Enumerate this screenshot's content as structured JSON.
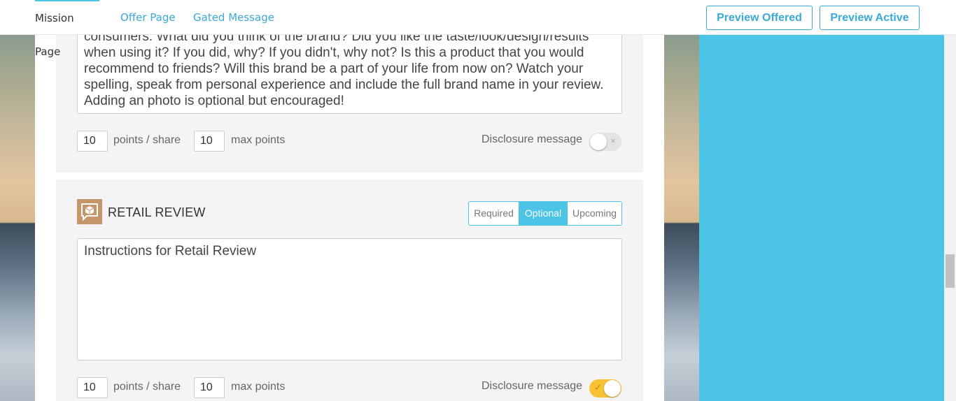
{
  "nav": {
    "tabs": [
      {
        "label": "Mission Page",
        "active": true
      },
      {
        "label": "Offer Page",
        "active": false
      },
      {
        "label": "Gated Message",
        "active": false
      }
    ],
    "preview_offered": "Preview Offered",
    "preview_active": "Preview Active"
  },
  "review_card": {
    "instructions": "consumers. What did you think of the brand? Did you like the taste/look/design/results when using it? If you did, why? If you didn't, why not? Is this a product that you would recommend to friends? Will this brand be a part of your life from now on? Watch your spelling, speak from personal experience and include the full brand name in your review. Adding an photo is optional but encouraged!",
    "points_per_share": "10",
    "points_per_share_label": "points / share",
    "max_points": "10",
    "max_points_label": "max points",
    "disclosure_label": "Disclosure message",
    "disclosure_on": false,
    "toggle_mark": "×"
  },
  "retail_card": {
    "title": "RETAIL REVIEW",
    "icon": "retail-review-icon",
    "modes": [
      "Required",
      "Optional",
      "Upcoming"
    ],
    "active_mode": "Optional",
    "instructions": "Instructions for Retail Review",
    "points_per_share": "10",
    "points_per_share_label": "points / share",
    "max_points": "10",
    "max_points_label": "max points",
    "disclosure_label": "Disclosure message",
    "disclosure_on": true,
    "toggle_mark": "✓"
  },
  "colors": {
    "accent": "#4bc4e6",
    "link": "#3aa9d6",
    "icon_bg": "#c6956a",
    "toggle_on": "#f7c234"
  }
}
